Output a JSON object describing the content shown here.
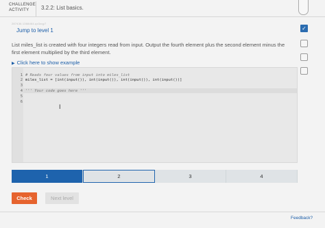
{
  "header": {
    "badge_line1": "CHALLENGE",
    "badge_line2": "ACTIVITY",
    "title": "3.2.2: List basics."
  },
  "activity": {
    "meta_id": "287436.1368464.qx3zqy7",
    "jump_label": "Jump to level 1",
    "description": "List miles_list is created with four integers read from input. Output the fourth element plus the second element minus the first element multiplied by the third element.",
    "example_label": "Click here to show example",
    "example_icon": "triangle-right-icon"
  },
  "editor": {
    "lines": [
      {
        "num": "1",
        "text": "# Reads four values from input into miles_list"
      },
      {
        "num": "2",
        "text": "miles_list = [int(input()), int(input()), int(input()), int(input())]"
      },
      {
        "num": "3",
        "text": ""
      },
      {
        "num": "4",
        "text": "''' Your code goes here '''"
      },
      {
        "num": "5",
        "text": ""
      },
      {
        "num": "6",
        "text": ""
      }
    ],
    "cursor_glyph": "I"
  },
  "progress": {
    "levels": [
      "1",
      "2",
      "3",
      "4"
    ],
    "current_level": 1
  },
  "buttons": {
    "check": "Check",
    "next_level": "Next level"
  },
  "footer": {
    "feedback": "Feedback?"
  },
  "colors": {
    "accent_blue": "#1e63ad",
    "check_orange": "#e6632e"
  }
}
